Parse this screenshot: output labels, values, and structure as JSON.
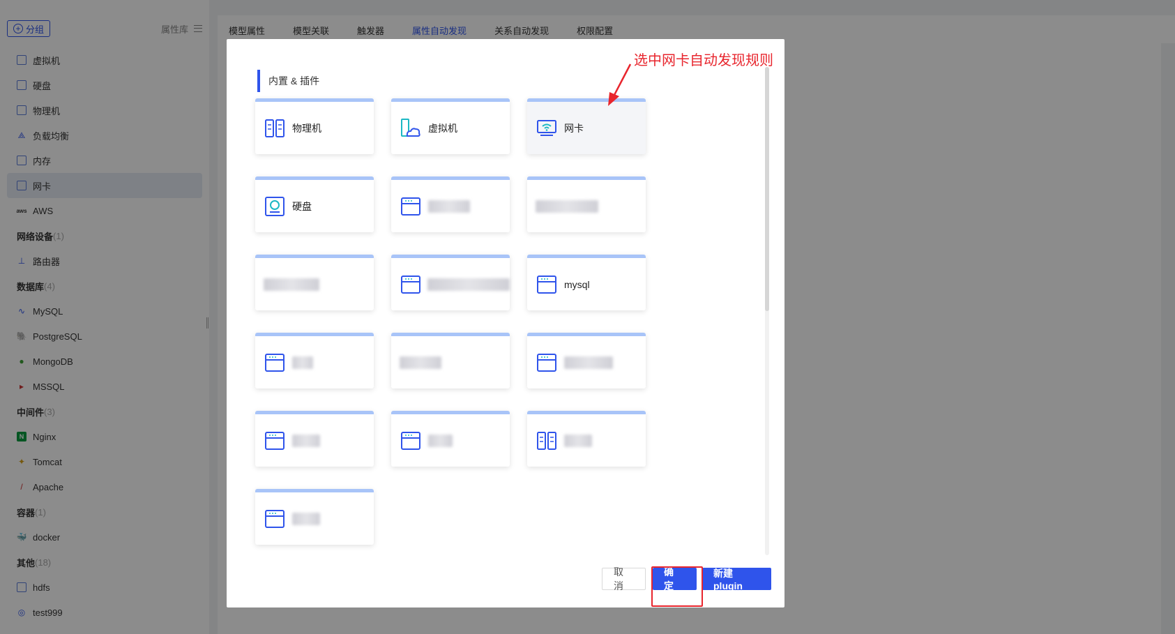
{
  "sidebar": {
    "group_button": "分组",
    "prop_lib": "属性库",
    "items": [
      {
        "label": "虚拟机",
        "icon": "virtual-machine-icon",
        "group": false
      },
      {
        "label": "硬盘",
        "icon": "disk-icon",
        "group": false
      },
      {
        "label": "物理机",
        "icon": "physical-machine-icon",
        "group": false
      },
      {
        "label": "负载均衡",
        "icon": "load-balancer-icon",
        "group": false
      },
      {
        "label": "内存",
        "icon": "memory-icon",
        "group": false
      },
      {
        "label": "网卡",
        "icon": "nic-icon",
        "group": false,
        "active": true
      },
      {
        "label": "AWS",
        "icon": "aws-icon",
        "group": false
      }
    ],
    "groups": {
      "network": {
        "label": "网络设备",
        "count": "(1)"
      },
      "database": {
        "label": "数据库",
        "count": "(4)"
      },
      "middleware": {
        "label": "中间件",
        "count": "(3)"
      },
      "container": {
        "label": "容器",
        "count": "(1)"
      },
      "other": {
        "label": "其他",
        "count": "(18)"
      }
    },
    "network_items": [
      "路由器"
    ],
    "database_items": [
      "MySQL",
      "PostgreSQL",
      "MongoDB",
      "MSSQL"
    ],
    "middleware_items": [
      "Nginx",
      "Tomcat",
      "Apache"
    ],
    "container_items": [
      "docker"
    ],
    "other_items": [
      "hdfs",
      "test999"
    ]
  },
  "tabs": [
    "模型属性",
    "模型关联",
    "触发器",
    "属性自动发现",
    "关系自动发现",
    "权限配置"
  ],
  "active_tab": "属性自动发现",
  "modal": {
    "section_title": "内置 & 插件",
    "cards": [
      {
        "label": "物理机",
        "icon": "physical-machine-icon"
      },
      {
        "label": "虚拟机",
        "icon": "virtual-machine-icon"
      },
      {
        "label": "网卡",
        "icon": "nic-icon",
        "selected": true
      },
      {
        "label": "硬盘",
        "icon": "disk-icon"
      },
      {
        "label": "",
        "icon": "plugin-icon",
        "blurred": true
      },
      {
        "label": "",
        "icon": "",
        "blurred": true
      },
      {
        "label": "",
        "icon": "",
        "blurred": true
      },
      {
        "label": "",
        "icon": "plugin-icon",
        "blurred": true
      },
      {
        "label": "mysql",
        "icon": "plugin-icon"
      },
      {
        "label": "",
        "icon": "plugin-icon",
        "blurred": true
      },
      {
        "label": "",
        "icon": "",
        "blurred": true
      },
      {
        "label": "",
        "icon": "plugin-icon",
        "blurred": true
      },
      {
        "label": "",
        "icon": "plugin-icon",
        "blurred": true
      },
      {
        "label": "",
        "icon": "plugin-icon",
        "blurred": true
      },
      {
        "label": "",
        "icon": "physical-machine-icon",
        "blurred": true
      },
      {
        "label": "",
        "icon": "plugin-icon",
        "blurred": true
      }
    ],
    "cancel": "取消",
    "ok": "确定",
    "new_plugin": "新建plugin"
  },
  "annotation": "选中网卡自动发现规则",
  "colors": {
    "primary": "#2f54eb",
    "annotation": "#e8252d",
    "card_top": "#a8c4f8"
  }
}
